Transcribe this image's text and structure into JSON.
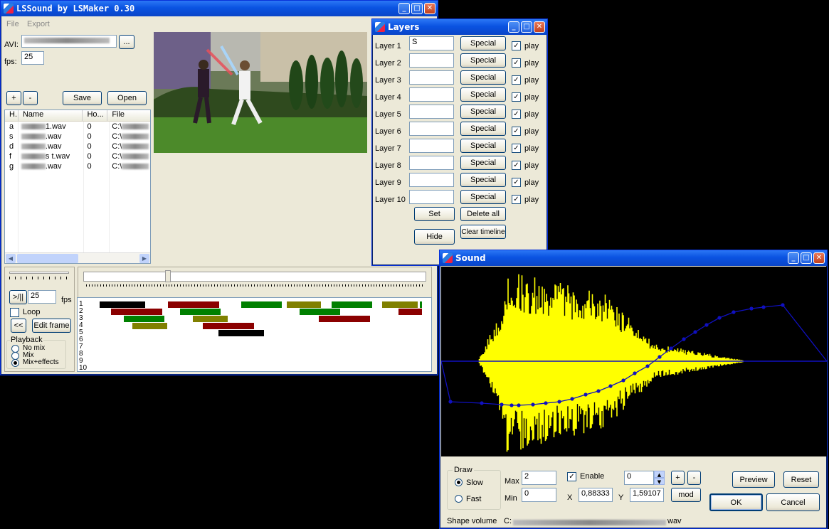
{
  "main": {
    "title": "LSSound by LSMaker 0.30",
    "menu": [
      "File",
      "Export"
    ],
    "avi_label": "AVI:",
    "avi_browse": "...",
    "fps_label": "fps:",
    "fps_value": "25",
    "plus_label": "+",
    "minus_label": "-",
    "save_label": "Save",
    "open_label": "Open",
    "columns": [
      "H.",
      "Name",
      "Ho...",
      "File"
    ],
    "rows": [
      {
        "h": "a",
        "name": "1.wav",
        "ho": "0",
        "file": "C:\\"
      },
      {
        "h": "s",
        "name": ".wav",
        "ho": "0",
        "file": "C:\\"
      },
      {
        "h": "d",
        "name": ".wav",
        "ho": "0",
        "file": "C:\\"
      },
      {
        "h": "f",
        "name": "s       t.wav",
        "ho": "0",
        "file": "C:\\"
      },
      {
        "h": "g",
        "name": ".wav",
        "ho": "0",
        "file": "C:\\"
      }
    ],
    "play_label": ">/||",
    "play_fps": "25",
    "play_fps_label": "fps",
    "loop_label": "Loop",
    "rewind_label": "<<",
    "edit_frame_label": "Edit frame",
    "playback_label": "Playback",
    "playback_options": [
      "No mix",
      "Mix",
      "Mix+effects"
    ],
    "timeline_rows": [
      "1",
      "2",
      "3",
      "4",
      "5",
      "6",
      "7",
      "8",
      "9",
      "10"
    ]
  },
  "layers": {
    "title": "Layers",
    "items": [
      {
        "label": "Layer 1",
        "value": "S",
        "special": "Special",
        "play": "play"
      },
      {
        "label": "Layer 2",
        "value": "",
        "special": "Special",
        "play": "play"
      },
      {
        "label": "Layer 3",
        "value": "",
        "special": "Special",
        "play": "play"
      },
      {
        "label": "Layer 4",
        "value": "",
        "special": "Special",
        "play": "play"
      },
      {
        "label": "Layer 5",
        "value": "",
        "special": "Special",
        "play": "play"
      },
      {
        "label": "Layer 6",
        "value": "",
        "special": "Special",
        "play": "play"
      },
      {
        "label": "Layer 7",
        "value": "",
        "special": "Special",
        "play": "play"
      },
      {
        "label": "Layer 8",
        "value": "",
        "special": "Special",
        "play": "play"
      },
      {
        "label": "Layer 9",
        "value": "",
        "special": "Special",
        "play": "play"
      },
      {
        "label": "Layer 10",
        "value": "",
        "special": "Special",
        "play": "play"
      }
    ],
    "set_label": "Set",
    "delete_all_label": "Delete all",
    "hide_label": "Hide",
    "clear_timeline_label": "Clear timeline"
  },
  "sound": {
    "title": "Sound",
    "draw_label": "Draw",
    "slow_label": "Slow",
    "fast_label": "Fast",
    "max_label": "Max",
    "max_value": "2",
    "min_label": "Min",
    "min_value": "0",
    "enable_label": "Enable",
    "spin_value": "0",
    "plus_label": "+",
    "minus_label": "-",
    "x_label": "X",
    "x_value": "0,88333",
    "y_label": "Y",
    "y_value": "1,59107",
    "mod_label": "mod",
    "preview_label": "Preview",
    "reset_label": "Reset",
    "ok_label": "OK",
    "cancel_label": "Cancel",
    "shape_volume_label": "Shape volume",
    "shape_volume_path_prefix": "C:",
    "shape_volume_path_suffix": "wav"
  },
  "colors": {
    "waveform": "#ffff00",
    "curve": "#1010c0",
    "tl_black": "#000000",
    "tl_red": "#8b0000",
    "tl_green": "#008000",
    "tl_olive": "#808000"
  }
}
